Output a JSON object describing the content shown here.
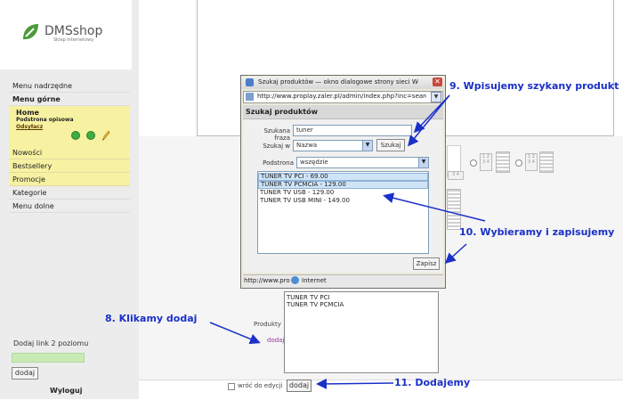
{
  "sidebar": {
    "logo_text": "DMSshop",
    "logo_subtext": "Sklep internetowy",
    "menu": [
      {
        "label": "Menu nadrzędne",
        "style": "normal"
      },
      {
        "label": "Menu górne",
        "style": "bold"
      }
    ],
    "home": {
      "title": "Home",
      "subtitle": "Podstrona opisowa",
      "link": "Odsyłacz"
    },
    "submenu": [
      {
        "label": "Nowości"
      },
      {
        "label": "Bestsellery"
      },
      {
        "label": "Promocje"
      }
    ],
    "menu_after": [
      {
        "label": "Kategorie"
      },
      {
        "label": "Menu dolne"
      }
    ],
    "add_level2_label": "Dodaj link 2 poziomu",
    "add_button": "dodaj",
    "logout": "Wyloguj"
  },
  "dialog": {
    "window_title": "Szukaj produktów — okno dialogowe strony sieci Web",
    "url": "http://www.proplay.zaler.pl/admin/index.php?inc=search_",
    "header": "Szukaj produktów",
    "phrase_label": "Szukana fraza",
    "phrase_value": "tuner",
    "search_in_label": "Szukaj w",
    "search_in_value": "Nazwa",
    "search_button": "Szukaj",
    "subpage_label": "Podstrona",
    "subpage_value": "wszędzie",
    "results": [
      {
        "text": "TUNER TV PCI - 69.00",
        "selected": true
      },
      {
        "text": "TUNER TV PCMCIA - 129.00",
        "selected": true
      },
      {
        "text": "TUNER TV USB - 129.00",
        "selected": false
      },
      {
        "text": "TUNER TV USB MINI - 149.00",
        "selected": false
      }
    ],
    "save_button": "Zapisz",
    "status_url": "http://www.pro",
    "status_zone": "Internet"
  },
  "main": {
    "products_label": "Produkty",
    "add_link": "dodaj",
    "products": [
      "TUNER TV PCI",
      "TUNER TV PCMCIA"
    ],
    "return_label": "wróć do edycji",
    "add_button": "dodaj",
    "grid_cells": [
      "1",
      "2",
      "3",
      "4"
    ]
  },
  "annotations": {
    "step9": "9. Wpisujemy szykany produkt",
    "step10": "10. Wybieramy i zapisujemy",
    "step8": "8. Klikamy dodaj",
    "step11": "11. Dodajemy"
  },
  "colors": {
    "annotation": "#1a30c8",
    "sidebar_highlight": "#f7f2a2",
    "list_selection": "#cfe4f7"
  }
}
